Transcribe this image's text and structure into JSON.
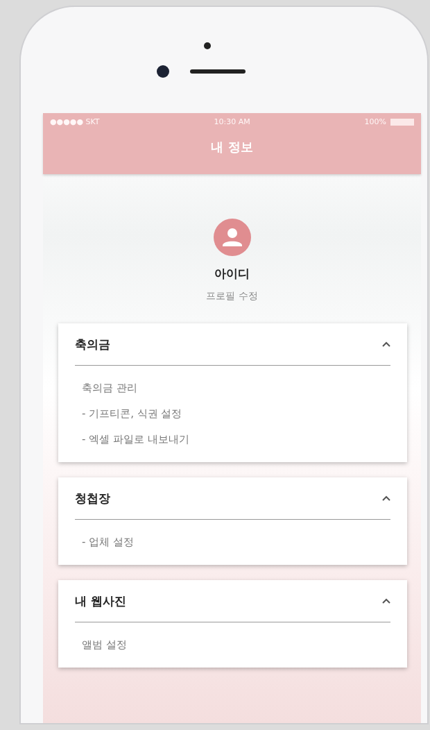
{
  "status_bar": {
    "carrier": "●●●●● SKT",
    "time": "10:30 AM",
    "battery": "100%"
  },
  "header": {
    "title": "내 정보"
  },
  "profile": {
    "name": "아이디",
    "edit_link": "프로필 수정"
  },
  "sections": [
    {
      "title": "축의금",
      "expanded": true,
      "items": [
        "축의금 관리",
        "- 기프티콘, 식권 설정",
        "- 엑셀 파일로 내보내기"
      ]
    },
    {
      "title": "청첩장",
      "expanded": true,
      "items": [
        "- 업체 설정"
      ]
    },
    {
      "title": "내 웹사진",
      "expanded": true,
      "items": [
        "앨범 설정"
      ]
    }
  ]
}
